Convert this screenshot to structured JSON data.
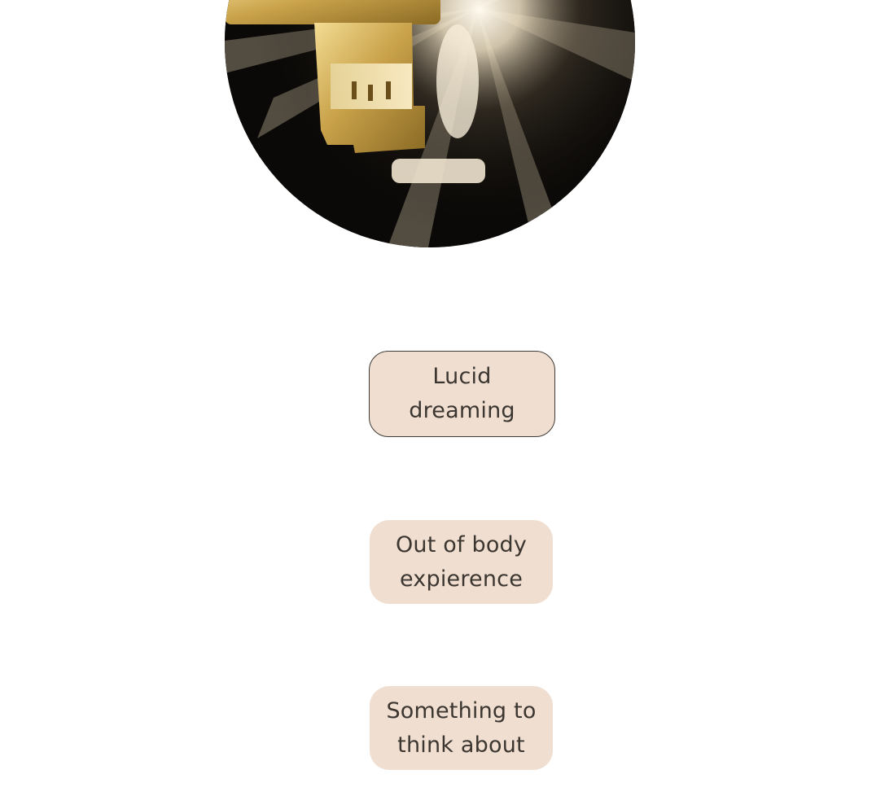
{
  "hero": {
    "image_name": "golden-key-in-keyhole-image"
  },
  "links": [
    {
      "label": "Lucid\ndreaming"
    },
    {
      "label": "Out of body\nexpierence"
    },
    {
      "label": "Something to\nthink about"
    }
  ],
  "colors": {
    "background": "#ffffff",
    "pill_fill": "#f0dfd1",
    "pill_text": "#3c3631",
    "pill_border": "#3f3a36",
    "key_gold": "#c9a24a"
  }
}
